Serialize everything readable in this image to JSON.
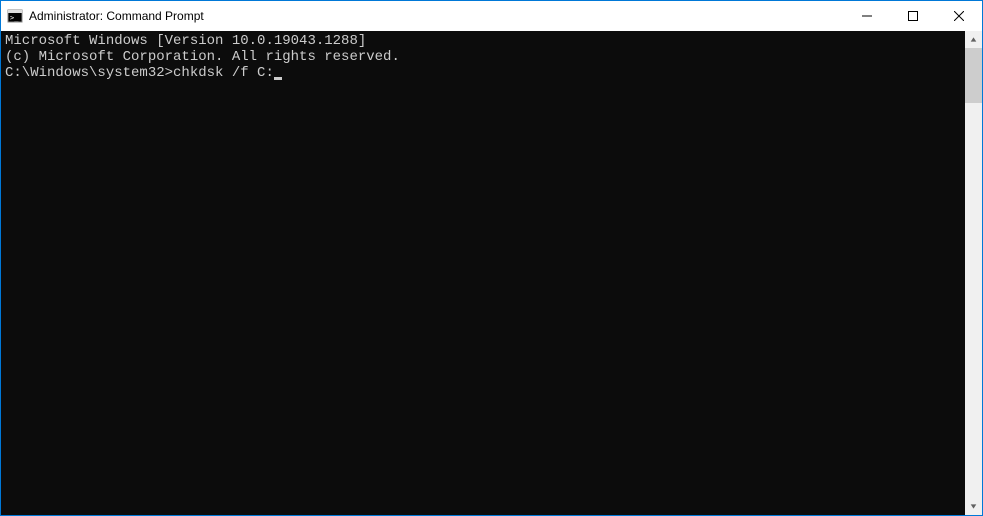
{
  "titlebar": {
    "title": "Administrator: Command Prompt"
  },
  "terminal": {
    "line1": "Microsoft Windows [Version 10.0.19043.1288]",
    "line2": "(c) Microsoft Corporation. All rights reserved.",
    "blank": "",
    "prompt": "C:\\Windows\\system32>",
    "command": "chkdsk /f C:"
  }
}
